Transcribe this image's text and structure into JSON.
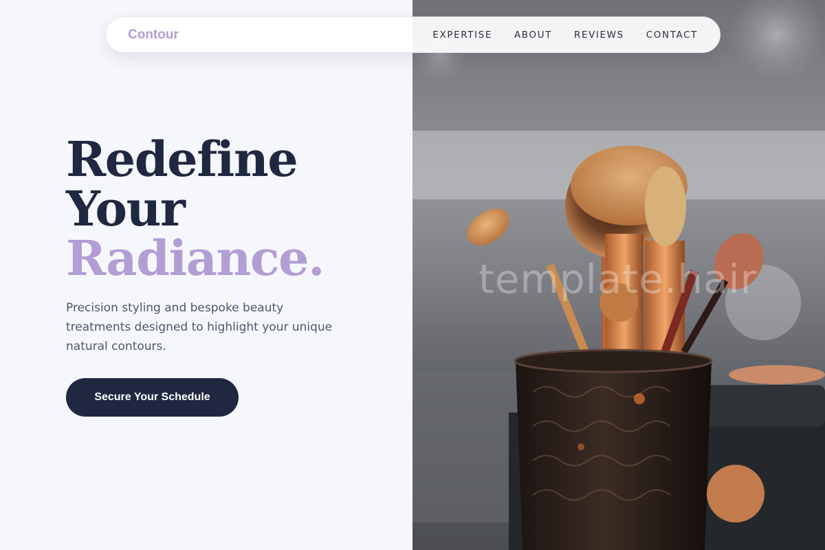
{
  "nav": {
    "brand": "Contour",
    "links": [
      {
        "label": "EXPERTISE"
      },
      {
        "label": "ABOUT"
      },
      {
        "label": "REVIEWS"
      },
      {
        "label": "CONTACT"
      }
    ]
  },
  "hero": {
    "title_line1": "Redefine",
    "title_line2": "Your",
    "title_accent": "Radiance.",
    "subtitle": "Precision styling and bespoke beauty treatments designed to highlight your unique natural contours.",
    "cta_label": "Secure Your Schedule"
  },
  "image": {
    "subject": "makeup brushes in an ornate holder",
    "watermark": "template.hair"
  },
  "colors": {
    "accent": "#b29dd4",
    "primary": "#1f2840",
    "background": "#f6f7fc",
    "body_text": "#4d5668"
  }
}
